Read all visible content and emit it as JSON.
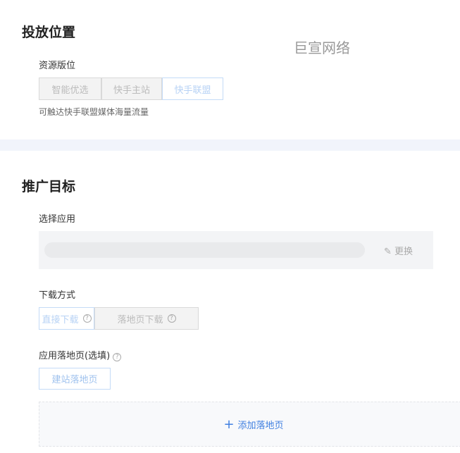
{
  "placement": {
    "title": "投放位置",
    "resource_label": "资源版位",
    "options": [
      "智能优选",
      "快手主站",
      "快手联盟"
    ],
    "selected": 2,
    "hint": "可触达快手联盟媒体海量流量"
  },
  "watermark": "巨宣网络",
  "goal": {
    "title": "推广目标",
    "app_label": "选择应用",
    "change_label": "更换",
    "download_label": "下载方式",
    "download_options": [
      "直接下载",
      "落地页下载"
    ],
    "landing_label": "应用落地页(选填)",
    "build_button": "建站落地页",
    "add_button": "添加落地页"
  }
}
